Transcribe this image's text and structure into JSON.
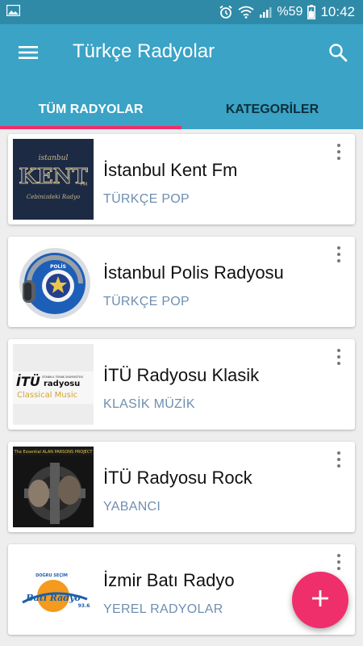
{
  "status_bar": {
    "battery": "%59",
    "time": "10:42",
    "left_icon": "image-icon",
    "icons": [
      "alarm-icon",
      "wifi-icon",
      "signal-icon",
      "battery-icon"
    ]
  },
  "app_bar": {
    "title": "Türkçe Radyolar",
    "menu_icon": "menu-icon",
    "search_icon": "search-icon"
  },
  "tabs": [
    {
      "label": "TÜM RADYOLAR",
      "active": true
    },
    {
      "label": "KATEGORİLER",
      "active": false
    }
  ],
  "stations": [
    {
      "name": "İstanbul Kent Fm",
      "category": "TÜRKÇE POP"
    },
    {
      "name": "İstanbul Polis Radyosu",
      "category": "TÜRKÇE POP"
    },
    {
      "name": "İTÜ Radyosu Klasik",
      "category": "KLASİK MÜZİK"
    },
    {
      "name": "İTÜ Radyosu Rock",
      "category": "YABANCI"
    },
    {
      "name": "İzmir Batı Radyo",
      "category": "YEREL RADYOLAR"
    }
  ],
  "logos": {
    "kent": {
      "top": "istanbul",
      "main": "KENT",
      "fm": "FM",
      "sub": "Cebinizdeki Radyo"
    },
    "polis": {
      "text": "POLİS"
    },
    "itu_klasik": {
      "brand": "İTÜ",
      "word": "radyosu",
      "tiny": "İSTANBUL TEKNİK ÜNİVERSİTESİ",
      "sub": "Classical Music"
    },
    "itu_rock": {
      "text": "The Essential ALAN PARSONS PROJECT"
    },
    "izmir": {
      "top": "DOĞRU SEÇİM",
      "main": "Batı Radyo",
      "freq": "93.6"
    }
  },
  "fab": {
    "icon": "plus-icon"
  },
  "colors": {
    "status_bar": "#2f8aa8",
    "app_bar": "#3aa3c6",
    "accent": "#ee2f6c",
    "category_text": "#6e8fb0"
  }
}
